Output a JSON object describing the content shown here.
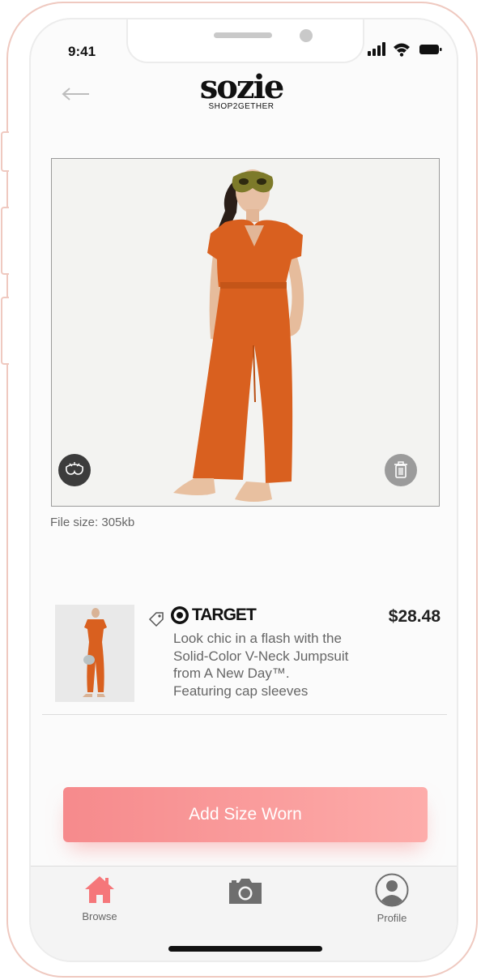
{
  "status_bar": {
    "time": "9:41"
  },
  "header": {
    "logo_main": "sozie",
    "logo_sub": "SHOP2GETHER"
  },
  "photo": {
    "file_size": "File size: 305kb"
  },
  "product": {
    "brand": "TARGET",
    "price": "$28.48",
    "description_lines": [
      "Look chic in a flash with the",
      "Solid-Color V-Neck Jumpsuit",
      "from A New Day™.",
      "Featuring cap sleeves"
    ]
  },
  "actions": {
    "add_size_label": "Add Size Worn"
  },
  "tabs": [
    {
      "label": "Browse",
      "icon": "home-icon",
      "active": true
    },
    {
      "label": "",
      "icon": "camera-icon",
      "active": false
    },
    {
      "label": "Profile",
      "icon": "profile-icon",
      "active": false
    }
  ],
  "colors": {
    "accent": "#f68a8c",
    "jumpsuit": "#d9601f",
    "target_red": "#111111"
  }
}
